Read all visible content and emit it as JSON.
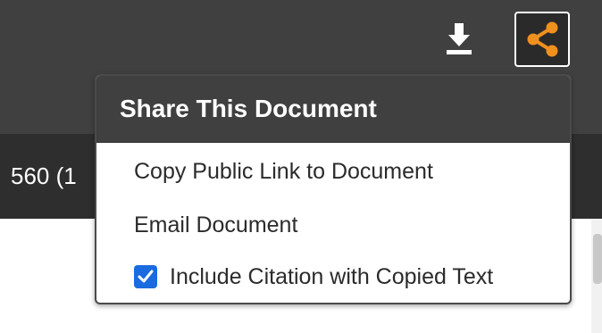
{
  "toolbar": {
    "download_icon": "download-icon",
    "share_icon": "share-icon",
    "share_icon_color": "#f0901e",
    "edge_glyph": ":"
  },
  "document": {
    "visible_text": "560 (1"
  },
  "share_popup": {
    "title": "Share This Document",
    "items": [
      {
        "label": "Copy Public Link to Document"
      },
      {
        "label": "Email Document"
      }
    ],
    "citation_option": {
      "label": "Include Citation with Copied Text",
      "checked": true,
      "checkbox_color": "#1a6be0"
    }
  }
}
